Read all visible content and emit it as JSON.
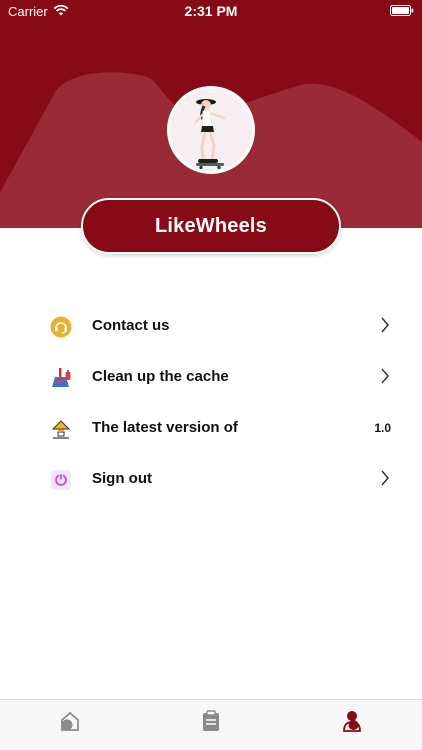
{
  "status_bar": {
    "carrier": "Carrier",
    "time": "2:31 PM"
  },
  "profile": {
    "name": "LikeWheels"
  },
  "menu": [
    {
      "label": "Contact us",
      "icon": "headset-icon",
      "action": "chevron"
    },
    {
      "label": "Clean up the cache",
      "icon": "broom-icon",
      "action": "chevron"
    },
    {
      "label": "The latest version of",
      "icon": "upgrade-icon",
      "value": "1.0"
    },
    {
      "label": "Sign out",
      "icon": "power-icon",
      "action": "chevron"
    }
  ],
  "tab_bar": {
    "tabs": [
      {
        "icon": "home-icon",
        "selected": false
      },
      {
        "icon": "clipboard-icon",
        "selected": false
      },
      {
        "icon": "profile-icon",
        "selected": true
      }
    ]
  },
  "colors": {
    "brand": "#870a17",
    "header_shape": "#9a2a35",
    "tab_inactive": "#8a8a8a",
    "tab_active": "#870a17"
  }
}
